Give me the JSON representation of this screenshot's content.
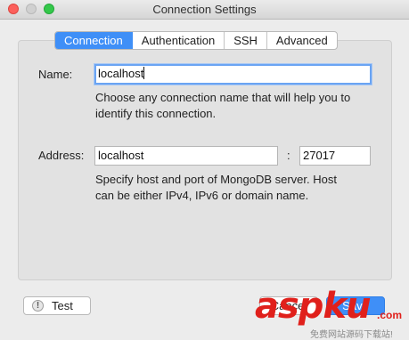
{
  "window": {
    "title": "Connection Settings"
  },
  "tabs": [
    {
      "label": "Connection",
      "active": true
    },
    {
      "label": "Authentication",
      "active": false
    },
    {
      "label": "SSH",
      "active": false
    },
    {
      "label": "Advanced",
      "active": false
    }
  ],
  "form": {
    "name_label": "Name:",
    "name_value": "localhost",
    "name_help": [
      "Choose any connection name that will help you to",
      "identify this connection."
    ],
    "address_label": "Address:",
    "host_value": "localhost",
    "port_separator": ":",
    "port_value": "27017",
    "address_help": [
      "Specify host and port of MongoDB server. Host",
      "can be either IPv4, IPv6 or domain name."
    ]
  },
  "buttons": {
    "test_label": "Test",
    "test_icon": "!",
    "cancel_label": "Cancel",
    "save_label": "Save"
  },
  "watermark": {
    "text": "aspku",
    "domain": ".com",
    "subtitle": "免费网站源码下载站!"
  },
  "colors": {
    "accent": "#3f8ff7",
    "watermark": "#e0201b"
  }
}
